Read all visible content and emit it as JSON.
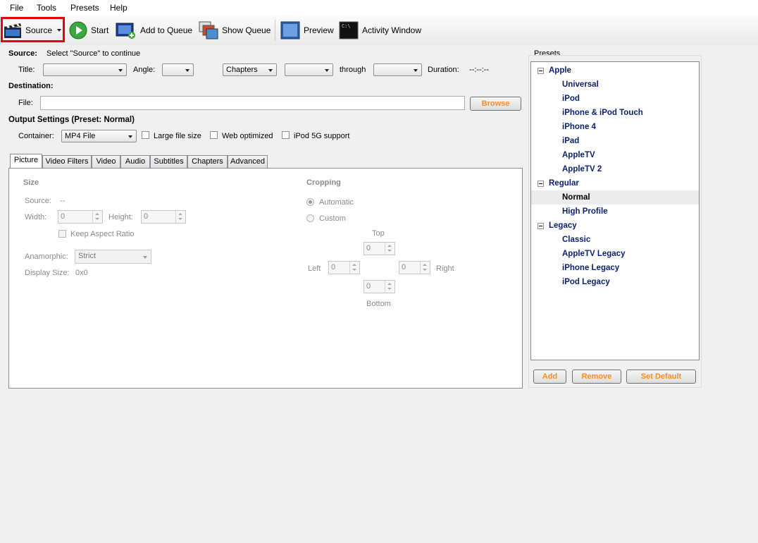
{
  "menu": [
    "File",
    "Tools",
    "Presets",
    "Help"
  ],
  "toolbar": {
    "source": "Source",
    "start": "Start",
    "add_to_queue": "Add to Queue",
    "show_queue": "Show Queue",
    "preview": "Preview",
    "activity_window": "Activity Window"
  },
  "source_section": {
    "label": "Source:",
    "hint": "Select \"Source\" to continue",
    "title_label": "Title:",
    "angle_label": "Angle:",
    "mode_value": "Chapters",
    "through_label": "through",
    "duration_label": "Duration:",
    "duration_value": "--:--:--"
  },
  "destination": {
    "label": "Destination:",
    "file_label": "File:",
    "file_value": "",
    "browse": "Browse"
  },
  "output": {
    "label": "Output Settings (Preset: Normal)",
    "container_label": "Container:",
    "container_value": "MP4 File",
    "large_file": "Large file size",
    "web_optimized": "Web optimized",
    "ipod5g": "iPod 5G support"
  },
  "tabs": [
    "Picture",
    "Video Filters",
    "Video",
    "Audio",
    "Subtitles",
    "Chapters",
    "Advanced"
  ],
  "picture": {
    "size_title": "Size",
    "source_label": "Source:",
    "source_value": "--",
    "width_label": "Width:",
    "width_value": "0",
    "height_label": "Height:",
    "height_value": "0",
    "keep_aspect": "Keep Aspect Ratio",
    "anamorphic_label": "Anamorphic:",
    "anamorphic_value": "Strict",
    "display_size_label": "Display Size:",
    "display_size_value": "0x0",
    "cropping_title": "Cropping",
    "automatic": "Automatic",
    "custom": "Custom",
    "top": "Top",
    "left": "Left",
    "right": "Right",
    "bottom": "Bottom",
    "top_value": "0",
    "left_value": "0",
    "right_value": "0",
    "bottom_value": "0"
  },
  "presets": {
    "title": "Presets",
    "groups": [
      {
        "name": "Apple",
        "items": [
          "Universal",
          "iPod",
          "iPhone & iPod Touch",
          "iPhone 4",
          "iPad",
          "AppleTV",
          "AppleTV 2"
        ]
      },
      {
        "name": "Regular",
        "items": [
          "Normal",
          "High Profile"
        ]
      },
      {
        "name": "Legacy",
        "items": [
          "Classic",
          "AppleTV Legacy",
          "iPhone Legacy",
          "iPod Legacy"
        ]
      }
    ],
    "selected": "Normal",
    "add": "Add",
    "remove": "Remove",
    "set_default": "Set Default"
  },
  "colors": {
    "preset_text": "#0c2270",
    "button_text": "#ff8c1a",
    "highlight_border": "#e8000d"
  }
}
